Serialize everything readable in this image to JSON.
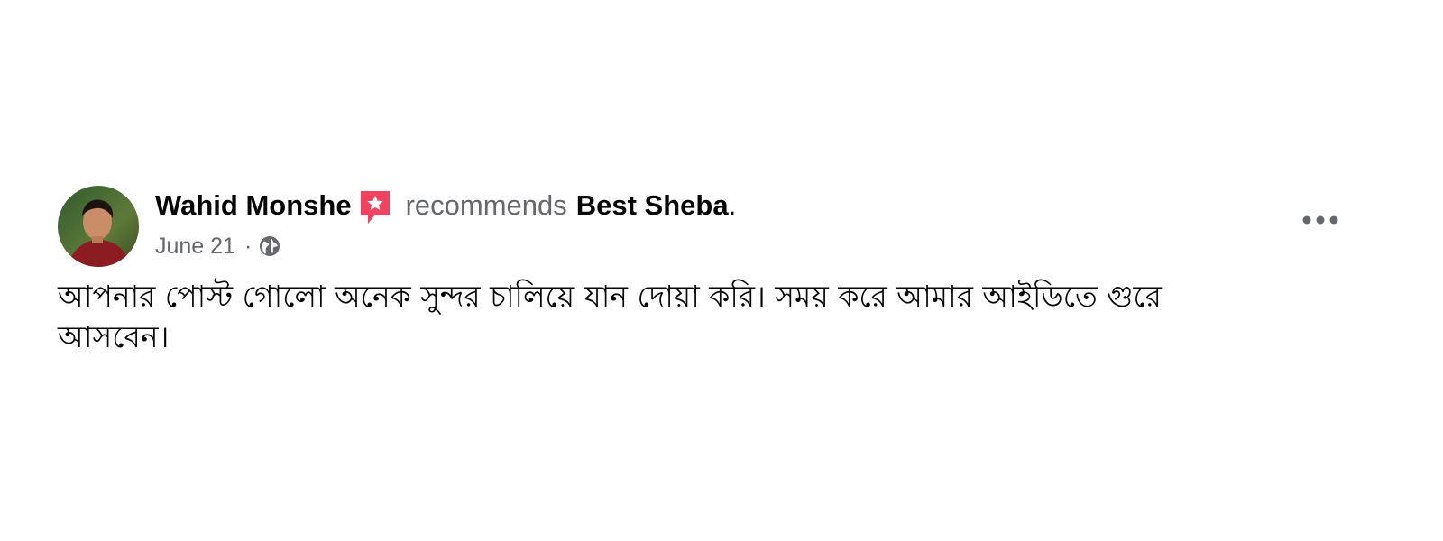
{
  "post": {
    "author": "Wahid Monshe",
    "action_text": "recommends",
    "page_name": "Best Sheba",
    "period": ".",
    "date": "June 21",
    "separator": "·",
    "privacy_icon": "globe-icon",
    "recommend_icon": "recommend-star-icon",
    "more_icon": "more-options-icon",
    "body": "আপনার পোস্ট গোলো অনেক সুন্দর চালিয়ে যান দোয়া করি। সময় করে আমার আইডিতে গুরে আসবেন।",
    "colors": {
      "primary_text": "#050505",
      "secondary_text": "#65676b",
      "recommend_badge": "#f3425f"
    }
  }
}
